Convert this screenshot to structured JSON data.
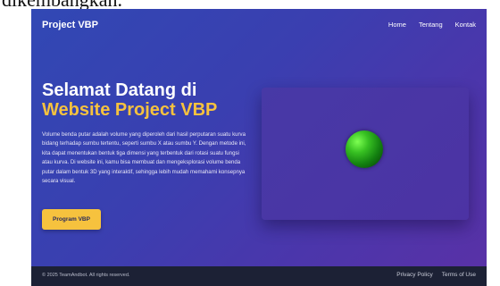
{
  "top_strip": {
    "text": "dikembangkan."
  },
  "navbar": {
    "brand": "Project VBP",
    "links": [
      "Home",
      "Tentang",
      "Kontak"
    ]
  },
  "hero": {
    "title_line1": "Selamat Datang di",
    "title_line2": "Website Project VBP",
    "description": "Volume benda putar adalah volume yang diperoleh dari hasil perputaran suatu kurva bidang terhadap sumbu tertentu, seperti sumbu X atau sumbu Y. Dengan metode ini, kita dapat menentukan bentuk tiga dimensi yang terbentuk dari rotasi suatu fungsi atau kurva. Di website ini, kamu bisa membuat dan mengeksplorasi volume benda putar dalam bentuk 3D yang interaktif, sehingga lebih mudah memahami konsepnya secara visual.",
    "cta_label": "Program VBP"
  },
  "footer": {
    "copyright": "© 2025 TeamAndbot. All rights reserved.",
    "links": [
      "Privacy Policy",
      "Terms of Use"
    ]
  },
  "colors": {
    "accent": "#f6c23e",
    "gradient_start": "#3148b4",
    "gradient_end": "#5a31a6",
    "footer_bg": "#1c2135",
    "sphere": "#37c022"
  }
}
